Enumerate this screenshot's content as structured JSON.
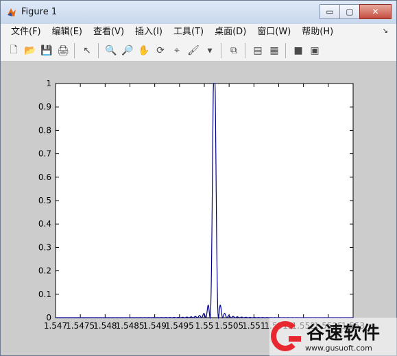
{
  "window": {
    "title": "Figure 1",
    "buttons": [
      "▭",
      "▢",
      "✕"
    ]
  },
  "menu": {
    "items": [
      "文件(F)",
      "编辑(E)",
      "查看(V)",
      "插入(I)",
      "工具(T)",
      "桌面(D)",
      "窗口(W)",
      "帮助(H)"
    ]
  },
  "toolbar": {
    "icons": [
      "new-figure-icon",
      "open-file-icon",
      "save-icon",
      "print-icon",
      "pointer-icon",
      "zoom-in-icon",
      "zoom-out-icon",
      "pan-icon",
      "rotate-3d-icon",
      "data-cursor-icon",
      "brush-icon",
      "dropdown-arrow-icon",
      "link-plot-icon",
      "colorbar-icon",
      "legend-icon",
      "hide-plot-tools-icon",
      "show-plot-tools-icon"
    ]
  },
  "chart_data": {
    "type": "line",
    "title": "",
    "xlabel": "",
    "ylabel": "",
    "xlim": [
      1.547,
      1.553
    ],
    "ylim": [
      0,
      1
    ],
    "xticks": [
      "1.547",
      "1.5475",
      "1.548",
      "1.5485",
      "1.549",
      "1.5495",
      "1.55",
      "1.5505",
      "1.551",
      "1.5515",
      "1.552",
      "1.5525",
      "1.553"
    ],
    "yticks": [
      "0",
      "0.1",
      "0.2",
      "0.3",
      "0.4",
      "0.5",
      "0.6",
      "0.7",
      "0.8",
      "0.9",
      "1"
    ],
    "center": 1.5502,
    "peak": 0.99,
    "line_color": "#00008b",
    "grid": false,
    "series": [
      {
        "name": "",
        "values": []
      }
    ]
  },
  "watermark": {
    "text": "谷速软件",
    "url": "www.gusuoft.com"
  }
}
